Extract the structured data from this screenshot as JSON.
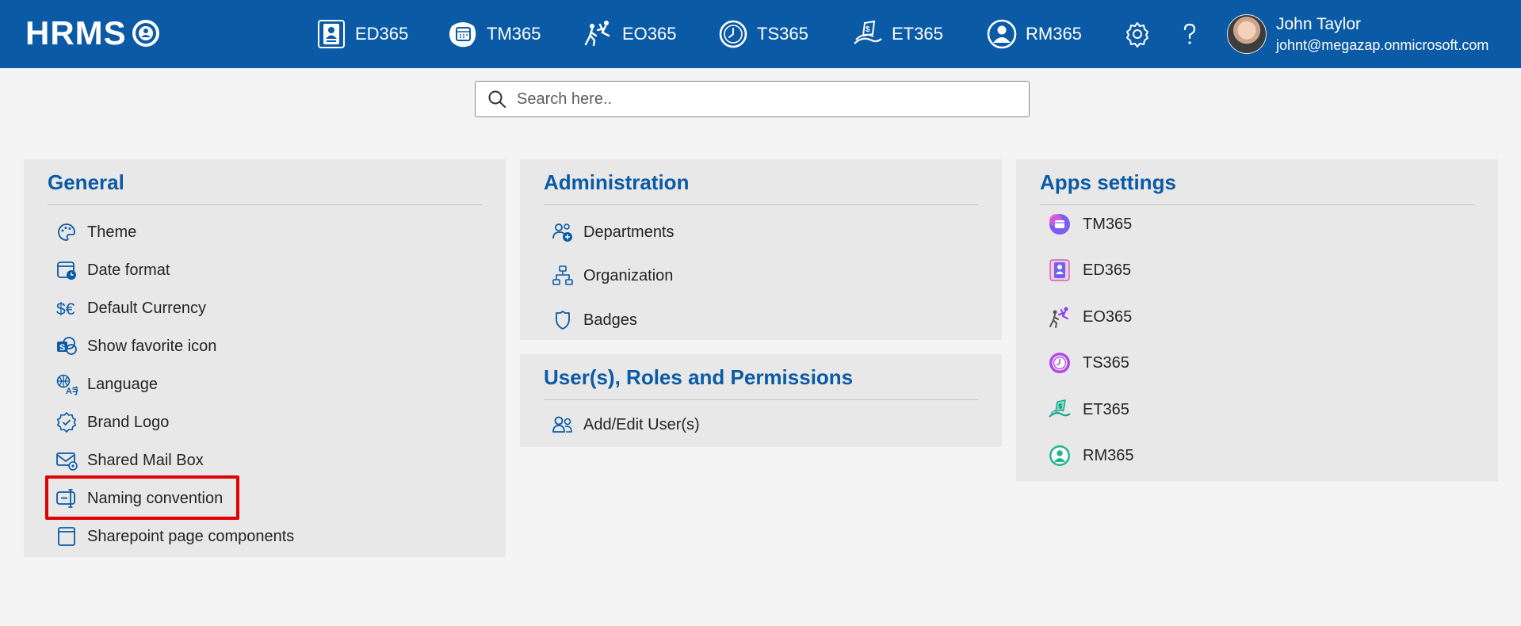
{
  "header": {
    "logo_text": "HRMS",
    "apps": [
      {
        "label": "ED365",
        "icon": "employee-directory-icon"
      },
      {
        "label": "TM365",
        "icon": "task-calendar-icon"
      },
      {
        "label": "EO365",
        "icon": "onboarding-people-icon"
      },
      {
        "label": "TS365",
        "icon": "clock-icon"
      },
      {
        "label": "ET365",
        "icon": "expense-money-icon"
      },
      {
        "label": "RM365",
        "icon": "user-circle-icon"
      }
    ],
    "settings_icon": "gear-icon",
    "help_icon": "question-icon",
    "user": {
      "name": "John Taylor",
      "email": "johnt@megazap.onmicrosoft.com"
    }
  },
  "search": {
    "placeholder": "Search here.."
  },
  "general": {
    "title": "General",
    "items": [
      {
        "label": "Theme",
        "icon": "palette-icon"
      },
      {
        "label": "Date format",
        "icon": "calendar-clock-icon"
      },
      {
        "label": "Default Currency",
        "icon": "currency-icon"
      },
      {
        "label": "Show favorite icon",
        "icon": "sharepoint-icon"
      },
      {
        "label": "Language",
        "icon": "language-icon"
      },
      {
        "label": "Brand Logo",
        "icon": "badge-check-icon"
      },
      {
        "label": "Shared Mail Box",
        "icon": "mail-settings-icon"
      },
      {
        "label": "Naming convention",
        "icon": "rename-icon"
      },
      {
        "label": "Sharepoint page components",
        "icon": "page-icon"
      }
    ],
    "highlighted_item": "Naming convention"
  },
  "administration": {
    "title": "Administration",
    "items": [
      {
        "label": "Departments",
        "icon": "people-add-icon"
      },
      {
        "label": "Organization",
        "icon": "org-chart-icon"
      },
      {
        "label": "Badges",
        "icon": "shield-icon"
      }
    ]
  },
  "users": {
    "title": "User(s), Roles and Permissions",
    "items": [
      {
        "label": "Add/Edit User(s)",
        "icon": "people-icon"
      }
    ]
  },
  "apps_settings": {
    "title": "Apps settings",
    "items": [
      {
        "label": "TM365",
        "icon": "tm365-logo-icon"
      },
      {
        "label": "ED365",
        "icon": "ed365-logo-icon"
      },
      {
        "label": "EO365",
        "icon": "eo365-logo-icon"
      },
      {
        "label": "TS365",
        "icon": "ts365-logo-icon"
      },
      {
        "label": "ET365",
        "icon": "et365-logo-icon"
      },
      {
        "label": "RM365",
        "icon": "rm365-logo-icon"
      }
    ]
  },
  "colors": {
    "brand": "#0b5aa6",
    "highlight": "#e00000",
    "panel": "#e8e8e8",
    "background": "#f4f4f4"
  }
}
